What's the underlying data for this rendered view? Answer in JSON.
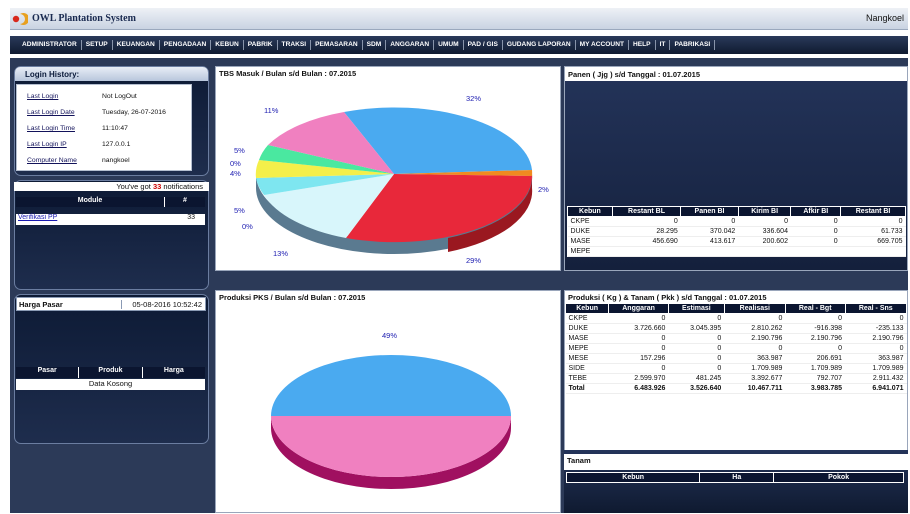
{
  "app": {
    "title": "OWL Plantation System",
    "user": "Nangkoel"
  },
  "menu": [
    "ADMINISTRATOR",
    "SETUP",
    "KEUANGAN",
    "PENGADAAN",
    "KEBUN",
    "PABRIK",
    "TRAKSI",
    "PEMASARAN",
    "SDM",
    "ANGGARAN",
    "UMUM",
    "PAD / GIS",
    "GUDANG LAPORAN",
    "MY ACCOUNT",
    "HELP",
    "IT",
    "PABRIKASI"
  ],
  "login": {
    "title": "Login History:",
    "rows": [
      {
        "label": "Last Login",
        "value": "Not LogOut"
      },
      {
        "label": "Last Login Date",
        "value": "Tuesday, 26-07-2016"
      },
      {
        "label": "Last Login Time",
        "value": "11:10:47"
      },
      {
        "label": "Last Login IP",
        "value": "127.0.0.1"
      },
      {
        "label": "Computer Name",
        "value": "nangkoel"
      }
    ]
  },
  "notifications": {
    "prefix": "You've got",
    "count": "33",
    "suffix": "notifications",
    "col_module": "Module",
    "col_count": "#",
    "rows": [
      {
        "module": "Verifikasi PP",
        "count": "33"
      }
    ]
  },
  "harga": {
    "label": "Harga Pasar",
    "datetime": "05-08-2016 10:52:42",
    "col_pasar": "Pasar",
    "col_produk": "Produk",
    "col_harga": "Harga",
    "empty": "Data Kosong"
  },
  "tbs_chart": {
    "title": "TBS Masuk / Bulan s/d Bulan : 07.2015",
    "labels": [
      "32%",
      "29%",
      "13%",
      "0%",
      "5%",
      "4%",
      "0%",
      "5%",
      "11%",
      "2%"
    ]
  },
  "pks_chart": {
    "title": "Produksi PKS / Bulan s/d Bulan : 07.2015",
    "labels": [
      "49%"
    ]
  },
  "panen": {
    "title": "Panen ( Jjg ) s/d Tanggal : 01.07.2015",
    "columns": [
      "Kebun",
      "Restant BL",
      "Panen BI",
      "Kirim BI",
      "Afkir BI",
      "Restant BI"
    ],
    "rows": [
      [
        "CKPE",
        "0",
        "0",
        "0",
        "0",
        "0"
      ],
      [
        "DUKE",
        "28.295",
        "370.042",
        "336.604",
        "0",
        "61.733"
      ],
      [
        "MASE",
        "456.690",
        "413.617",
        "200.602",
        "0",
        "669.705"
      ],
      [
        "MEPE",
        "",
        "",
        "",
        "",
        ""
      ]
    ]
  },
  "produksi": {
    "title": "Produksi ( Kg ) & Tanam ( Pkk ) s/d Tanggal : 01.07.2015",
    "columns": [
      "Kebun",
      "Anggaran",
      "Estimasi",
      "Realisasi",
      "Real - Bgt",
      "Real - Sns"
    ],
    "rows": [
      [
        "CKPE",
        "0",
        "0",
        "0",
        "0",
        "0"
      ],
      [
        "DUKE",
        "3.726.660",
        "3.045.395",
        "2.810.262",
        "-916.398",
        "-235.133"
      ],
      [
        "MASE",
        "0",
        "0",
        "2.190.796",
        "2.190.796",
        "2.190.796"
      ],
      [
        "MEPE",
        "0",
        "0",
        "0",
        "0",
        "0"
      ],
      [
        "MESE",
        "157.296",
        "0",
        "363.987",
        "206.691",
        "363.987"
      ],
      [
        "SIDE",
        "0",
        "0",
        "1.709.989",
        "1.709.989",
        "1.709.989"
      ],
      [
        "TEBE",
        "2.599.970",
        "481.245",
        "3.392.677",
        "792.707",
        "2.911.432"
      ],
      [
        "Total",
        "6.483.926",
        "3.526.640",
        "10.467.711",
        "3.983.785",
        "6.941.071"
      ]
    ],
    "tanam_title": "Tanam",
    "tanam_cols": [
      "Kebun",
      "Ha",
      "Pokok"
    ]
  }
}
